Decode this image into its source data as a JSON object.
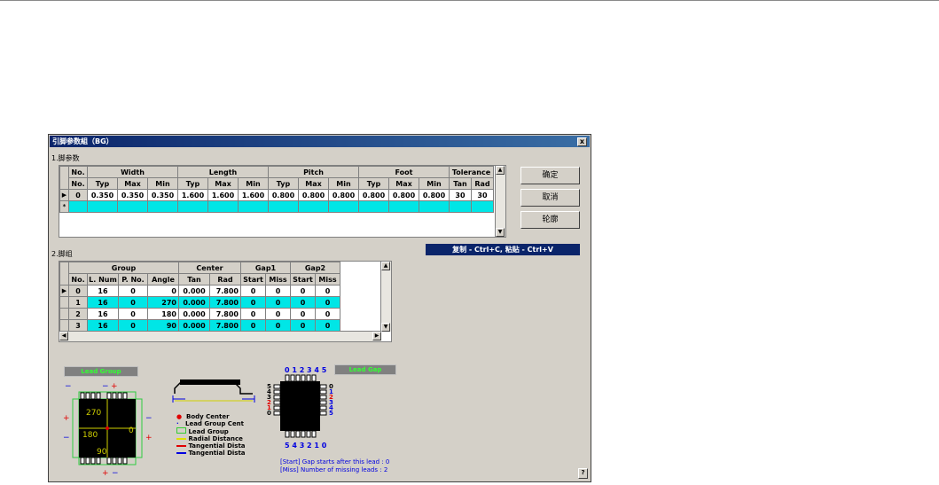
{
  "dialog": {
    "title": "引脚参数組（BG）",
    "close_label": "x",
    "help_label": "?"
  },
  "section1": {
    "label": "1.脚参数",
    "header_top": [
      "No.",
      "Width",
      "Length",
      "Pitch",
      "Foot",
      "Tolerance"
    ],
    "header_sub": [
      "No.",
      "Typ",
      "Max",
      "Min",
      "Typ",
      "Max",
      "Min",
      "Typ",
      "Max",
      "Min",
      "Typ",
      "Max",
      "Min",
      "Tan",
      "Rad"
    ],
    "rows": [
      [
        "0",
        "0.350",
        "0.350",
        "0.350",
        "1.600",
        "1.600",
        "1.600",
        "0.800",
        "0.800",
        "0.800",
        "0.800",
        "0.800",
        "0.800",
        "30",
        "30"
      ]
    ],
    "new_row_marker": "*"
  },
  "section2": {
    "label": "2.脚组",
    "header_top": [
      "Group",
      "Center",
      "Gap1",
      "Gap2"
    ],
    "header_sub": [
      "No.",
      "L. Num",
      "P. No.",
      "Angle",
      "Tan",
      "Rad",
      "Start",
      "Miss",
      "Start",
      "Miss"
    ],
    "rows": [
      [
        "0",
        "16",
        "0",
        "0",
        "0.000",
        "7.800",
        "0",
        "0",
        "0",
        "0"
      ],
      [
        "1",
        "16",
        "0",
        "270",
        "0.000",
        "7.800",
        "0",
        "0",
        "0",
        "0"
      ],
      [
        "2",
        "16",
        "0",
        "180",
        "0.000",
        "7.800",
        "0",
        "0",
        "0",
        "0"
      ],
      [
        "3",
        "16",
        "0",
        "90",
        "0.000",
        "7.800",
        "0",
        "0",
        "0",
        "0"
      ]
    ]
  },
  "buttons": {
    "ok": "确定",
    "cancel": "取消",
    "outline": "轮廓"
  },
  "copy_hint": "复制 - Ctrl+C, 粘贴 - Ctrl+V",
  "diagram": {
    "lead_group_btn": "Lead Group",
    "lead_gap_btn": "Lead Gap",
    "angles": [
      "270",
      "0",
      "180",
      "90"
    ],
    "legend": [
      {
        "text": "Body Center",
        "color": "#e00000"
      },
      {
        "text": "Lead Group Cent",
        "color": "#0000e0"
      },
      {
        "text": "Lead Group",
        "color": "#33cc33"
      },
      {
        "text": "Radial Distance",
        "color": "#e0e000"
      },
      {
        "text": "Tangential Dista",
        "color": "#e00000"
      },
      {
        "text": "Tangential Dista",
        "color": "#0000e0"
      }
    ],
    "top_numbers": "0 1 2 3 4 5",
    "bottom_numbers": "5 4 3 2 1 0",
    "left_numbers": [
      "5",
      "4",
      "3",
      "2",
      "1",
      "0"
    ],
    "right_numbers": [
      "0",
      "1",
      "2",
      "3",
      "4",
      "5"
    ],
    "start_note": "[Start] Gap starts after this lead : 0",
    "miss_note": "[Miss] Number of missing leads : 2"
  }
}
